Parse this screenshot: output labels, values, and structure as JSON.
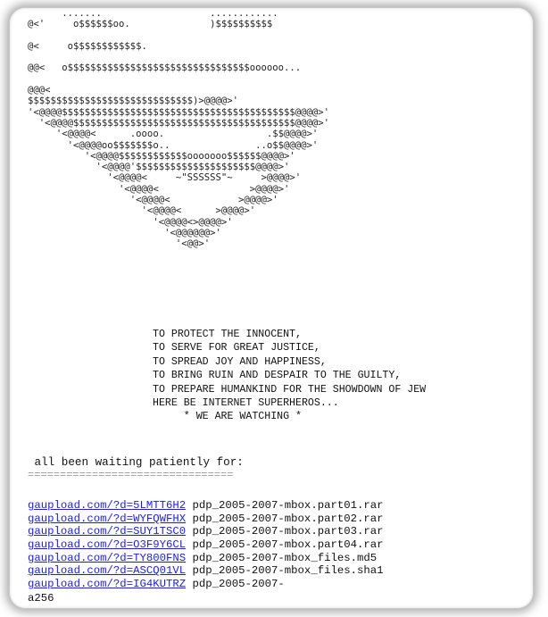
{
  "ascii_art": [
    "      .......                   ............",
    "@<'     o$$$$$$oo.              )$$$$$$$$$$",
    "",
    "@<     o$$$$$$$$$$$$.",
    "",
    "@@<   o$$$$$$$$$$$$$$$$$$$$$$$$$$$$$$$$oooooo...",
    "",
    "@@@<",
    "$$$$$$$$$$$$$$$$$$$$$$$$$$$$$)>@@@@>'",
    "'<@@@@$$$$$$$$$$$$$$$$$$$$$$$$$$$$$$$$$$$$$$$$$@@@@>'",
    "  '<@@@@$$$$$$$$$$$$$$$$$$$$$$$$$$$$$$$$$$$$$$$@@@@>'",
    "     '<@@@@<      .oooo.                  .$$@@@@>'",
    "       '<@@@@oo$$$$$$$o..               ..o$$@@@@>'",
    "          '<@@@@$$$$$$$$$$$$ooooooo$$$$$$@@@@>'",
    "            '<@@@@'$$$$$$$$$$$$$$$$$$$$$@@@@>'",
    "              '<@@@@<     ~\"SSSSSS\"~     >@@@@>'",
    "                '<@@@@<                >@@@@>'",
    "                  '<@@@@<            >@@@@>'",
    "                    '<@@@@<      >@@@@>'",
    "                      '<@@@@<>@@@@>'",
    "                        '<@@@@@@>'",
    "                          '<@@>'"
  ],
  "motto_lines": [
    "TO PROTECT THE INNOCENT,",
    "TO SERVE FOR GREAT JUSTICE,",
    "TO SPREAD JOY AND HAPPINESS,",
    "TO BRING RUIN AND DESPAIR TO THE GUILTY,",
    "TO PREPARE HUMANKIND FOR THE SHOWDOWN OF JEW",
    "HERE BE INTERNET SUPERHEROS...",
    "     * WE ARE WATCHING *"
  ],
  "intro_text": " all been waiting patiently for:",
  "rule_text": "================================",
  "files": [
    {
      "link": "gaupload.com/?d=5LMTT6H2",
      "name": "pdp_2005-2007-mbox.part01.rar"
    },
    {
      "link": "gaupload.com/?d=WYFQWFHX",
      "name": "pdp_2005-2007-mbox.part02.rar"
    },
    {
      "link": "gaupload.com/?d=SUY1TSC0",
      "name": "pdp_2005-2007-mbox.part03.rar"
    },
    {
      "link": "gaupload.com/?d=O3F9Y6CL",
      "name": "pdp_2005-2007-mbox.part04.rar"
    },
    {
      "link": "gaupload.com/?d=TY800FNS",
      "name": "pdp_2005-2007-mbox_files.md5"
    },
    {
      "link": "gaupload.com/?d=ASCQ01VL",
      "name": "pdp_2005-2007-mbox_files.sha1"
    },
    {
      "link": "gaupload.com/?d=IG4KUTRZ",
      "name": "pdp_2005-2007-"
    }
  ],
  "tail_text": "a256",
  "colors": {
    "link": "#1a1aff",
    "text": "#111111",
    "rule": "#9a9a9a"
  }
}
